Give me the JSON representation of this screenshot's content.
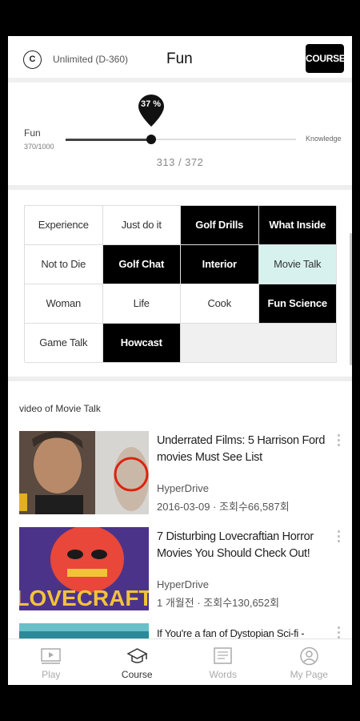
{
  "header": {
    "course_icon": "C",
    "plan": "Unlimited (D-360)",
    "title": "Fun",
    "course_button": "COURSE"
  },
  "progress": {
    "percent_label": "37 %",
    "fraction": 0.37,
    "left_label": "Fun",
    "left_sub": "370/1000",
    "right_label": "Knowledge",
    "count": "313 / 372"
  },
  "categories": [
    {
      "label": "Experience",
      "style": "plain"
    },
    {
      "label": "Just do it",
      "style": "plain"
    },
    {
      "label": "Golf Drills",
      "style": "dark"
    },
    {
      "label": "What Inside",
      "style": "dark"
    },
    {
      "label": "Not to Die",
      "style": "plain"
    },
    {
      "label": "Golf Chat",
      "style": "dark"
    },
    {
      "label": "Interior",
      "style": "dark"
    },
    {
      "label": "Movie Talk",
      "style": "selected"
    },
    {
      "label": "Woman",
      "style": "plain"
    },
    {
      "label": "Life",
      "style": "plain"
    },
    {
      "label": "Cook",
      "style": "plain"
    },
    {
      "label": "Fun Science",
      "style": "dark"
    },
    {
      "label": "Game Talk",
      "style": "plain"
    },
    {
      "label": "Howcast",
      "style": "dark"
    }
  ],
  "video_section": {
    "heading": "video of Movie Talk",
    "videos": [
      {
        "title": "Underrated Films: 5 Harrison Ford movies Must See List",
        "channel": "HyperDrive",
        "meta": "2016-03-09 · 조회수66,587회"
      },
      {
        "title": "7 Disturbing Lovecraftian Horror Movies You Should Check Out!",
        "channel": "HyperDrive",
        "meta": "1 개월전 · 조회수130,652회",
        "thumb_text": "LOVECRAFT"
      },
      {
        "title": "If You're a fan of Dystopian Sci-fi - Watch",
        "channel": "",
        "meta": ""
      }
    ]
  },
  "bottom_nav": [
    {
      "label": "Play",
      "icon": "play-icon",
      "active": false
    },
    {
      "label": "Course",
      "icon": "graduation-cap-icon",
      "active": true
    },
    {
      "label": "Words",
      "icon": "notebook-icon",
      "active": false
    },
    {
      "label": "My Page",
      "icon": "user-icon",
      "active": false
    }
  ]
}
